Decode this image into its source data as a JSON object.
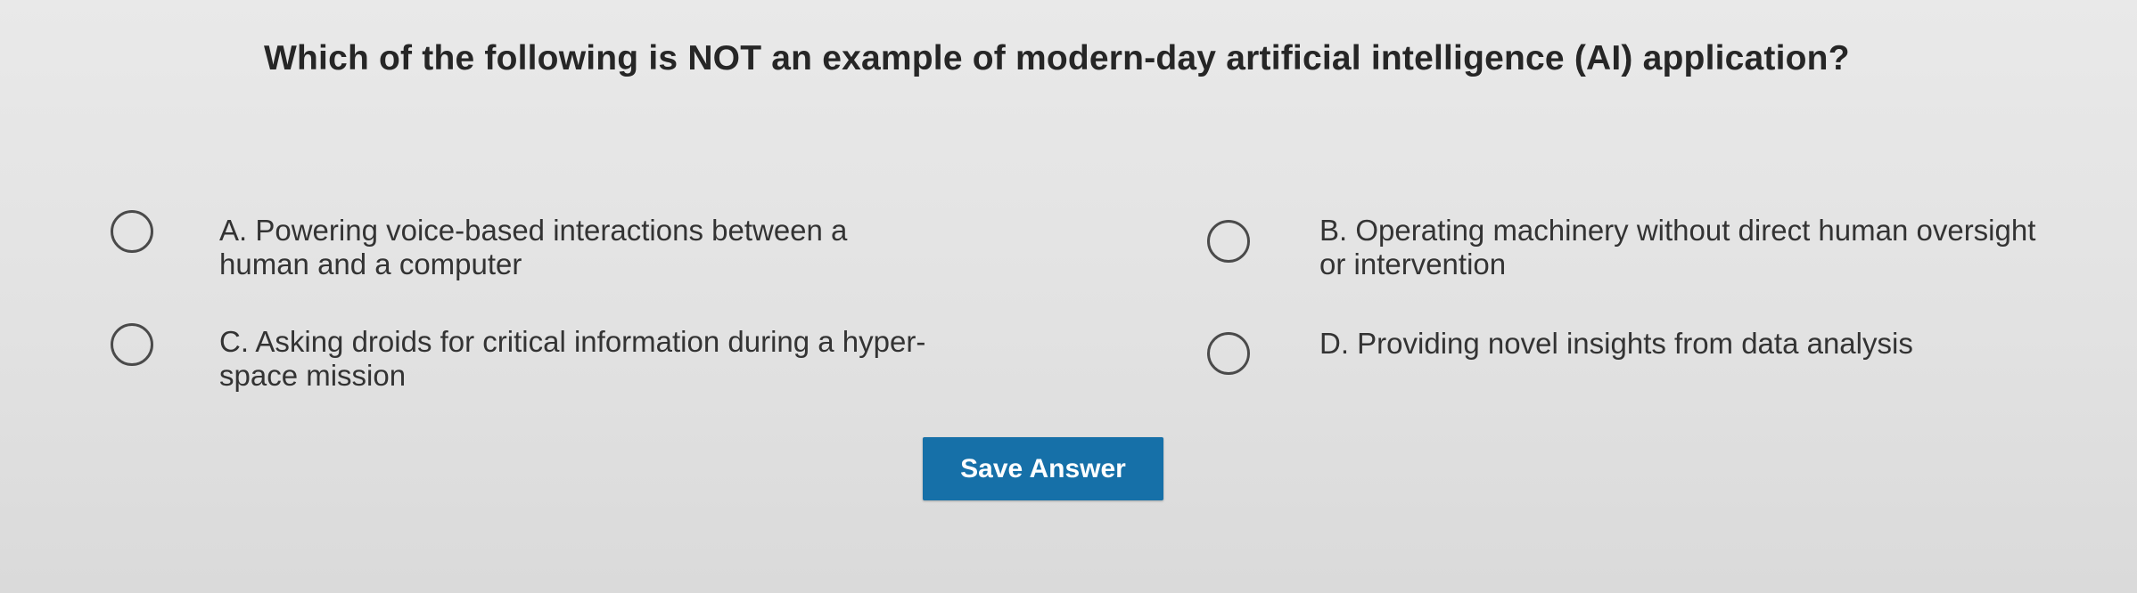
{
  "question": {
    "text": "Which of the following is NOT an example of modern-day artificial intelligence (AI) application?"
  },
  "options": [
    {
      "id": "A",
      "label": "A. Powering voice-based interactions between a\nhuman and a computer"
    },
    {
      "id": "B",
      "label": "B. Operating machinery without direct human oversight\nor intervention"
    },
    {
      "id": "C",
      "label": "C. Asking droids for critical information during a hyper-\nspace mission"
    },
    {
      "id": "D",
      "label": "D. Providing novel insights from data analysis"
    }
  ],
  "actions": {
    "save_label": "Save Answer"
  },
  "colors": {
    "button_background": "#1670a8",
    "button_text": "#ffffff",
    "radio_border": "#4a4a4a"
  },
  "icons": {
    "radio": "radio-unselected-icon"
  }
}
